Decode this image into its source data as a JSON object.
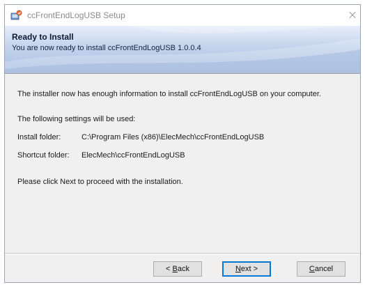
{
  "window": {
    "title": "ccFrontEndLogUSB Setup"
  },
  "banner": {
    "title": "Ready to Install",
    "subtitle": "You are now ready to install ccFrontEndLogUSB 1.0.0.4"
  },
  "content": {
    "intro": "The installer now has enough information to install ccFrontEndLogUSB on your computer.",
    "settings_heading": "The following settings will be used:",
    "install_folder_label": "Install folder:",
    "install_folder_value": "C:\\Program Files (x86)\\ElecMech\\ccFrontEndLogUSB",
    "shortcut_folder_label": "Shortcut folder:",
    "shortcut_folder_value": "ElecMech\\ccFrontEndLogUSB",
    "instruction": "Please click Next to proceed with the installation."
  },
  "buttons": {
    "back": {
      "prefix": "< ",
      "accel": "B",
      "rest": "ack"
    },
    "next": {
      "accel": "N",
      "rest": "ext >"
    },
    "cancel": {
      "accel": "C",
      "rest": "ancel"
    }
  },
  "icons": {
    "app": "installer-app-icon",
    "close": "close-icon"
  }
}
